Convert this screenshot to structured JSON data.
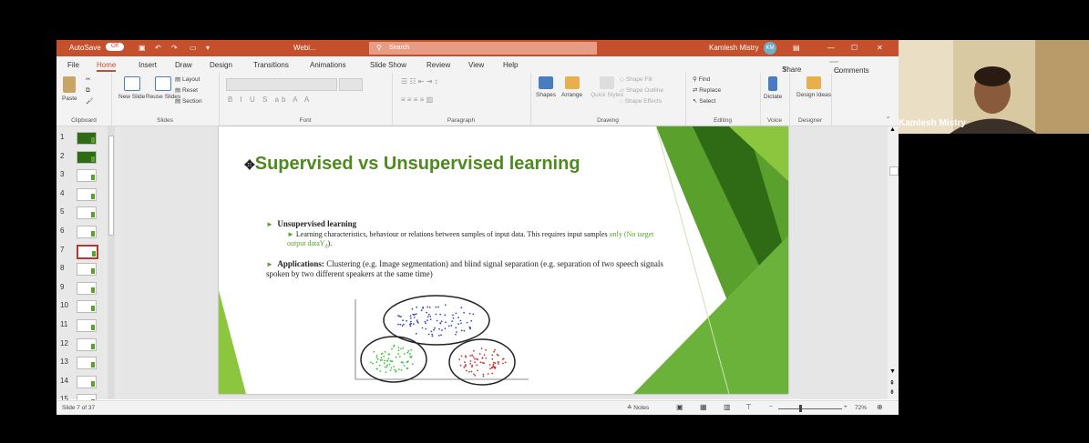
{
  "titlebar": {
    "autosave_label": "AutoSave",
    "autosave_state": "Off",
    "doc_title": "Webi...",
    "search_placeholder": "Search",
    "user_name": "Kamlesh Mistry",
    "user_initials": "KM"
  },
  "menu": {
    "tabs": [
      "File",
      "Home",
      "Insert",
      "Draw",
      "Design",
      "Transitions",
      "Animations",
      "Slide Show",
      "Review",
      "View",
      "Help"
    ],
    "active": "Home",
    "share": "Share",
    "comments": "Comments"
  },
  "ribbon": {
    "paste": "Paste",
    "new_slide": "New Slide",
    "reuse_slides": "Reuse Slides",
    "layout": "Layout",
    "reset": "Reset",
    "section": "Section",
    "shapes": "Shapes",
    "arrange": "Arrange",
    "quick_styles": "Quick Styles",
    "shape_fill": "Shape Fill",
    "shape_outline": "Shape Outline",
    "shape_effects": "Shape Effects",
    "find": "Find",
    "replace": "Replace",
    "select": "Select",
    "dictate": "Dictate",
    "design_ideas": "Design Ideas",
    "groups": [
      "Clipboard",
      "Slides",
      "Font",
      "Paragraph",
      "Drawing",
      "Editing",
      "Voice",
      "Designer"
    ]
  },
  "thumbnails": [
    "1",
    "2",
    "3",
    "4",
    "5",
    "6",
    "7",
    "8",
    "9",
    "10",
    "11",
    "12",
    "13",
    "14",
    "15"
  ],
  "selected_thumbnail": "7",
  "slide": {
    "title": "Supervised vs Unsupervised learning",
    "bullet1_head": "Unsupervised learning",
    "bullet1_sub": "Learning characteristics, behaviour or relations between samples of input data. This requires input samples ",
    "bullet1_sub_green": "only (No target output dataY",
    "bullet1_sub_green_sub": "d",
    "bullet1_sub_end": ").",
    "bullet2_head": "Applications:",
    "bullet2_text": "Clustering (e.g. Image segmentation) and blind signal separation (e.g. separation of two speech signals spoken by two different speakers at the same time)"
  },
  "status": {
    "slide_counter": "Slide 7 of 37",
    "notes": "Notes",
    "zoom": "72%"
  },
  "webcam": {
    "name": "Kamlesh Mistry"
  },
  "colors": {
    "titlebar": "#c4502e",
    "slide_green": "#5aa02c",
    "title_green": "#4e8a1e"
  }
}
